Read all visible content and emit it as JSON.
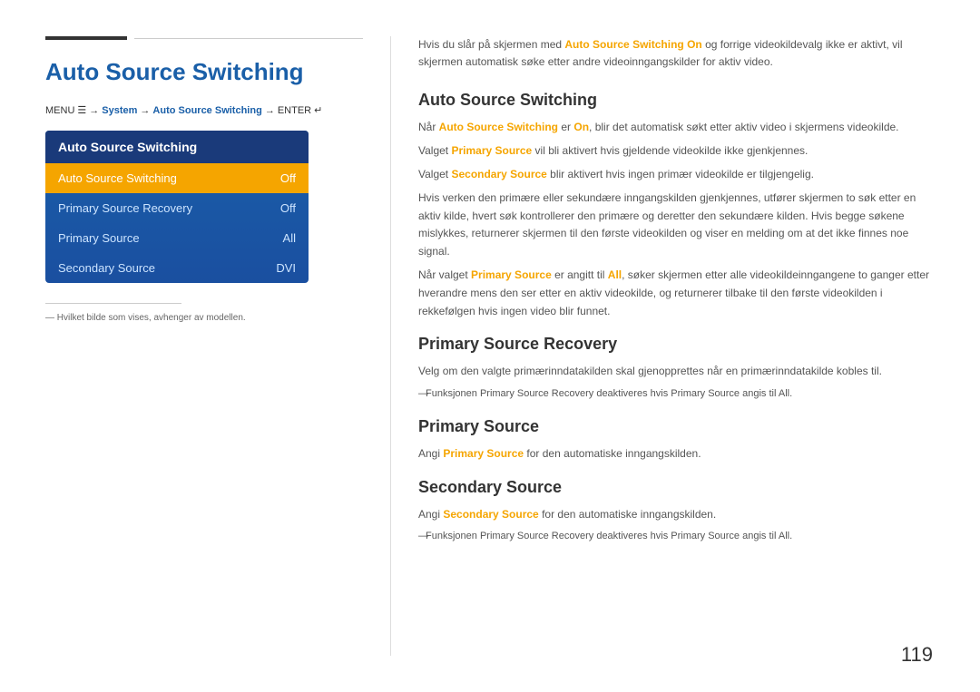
{
  "header": {
    "title": "Auto Source Switching"
  },
  "breadcrumb": {
    "menu": "MENU",
    "arrow1": "→",
    "system": "System",
    "arrow2": "→",
    "link": "Auto Source Switching",
    "arrow3": "→",
    "enter": "ENTER"
  },
  "osd": {
    "header": "Auto Source Switching",
    "items": [
      {
        "label": "Auto Source Switching",
        "value": "Off",
        "active": true
      },
      {
        "label": "Primary Source Recovery",
        "value": "Off",
        "active": false
      },
      {
        "label": "Primary Source",
        "value": "All",
        "active": false
      },
      {
        "label": "Secondary Source",
        "value": "DVI",
        "active": false
      }
    ]
  },
  "footnote": "— Hvilket bilde som vises, avhenger av modellen.",
  "right": {
    "intro": "Hvis du slår på skjermen med Auto Source Switching On og forrige videokildevalg ikke er aktivt, vil skjermen automatisk søke etter andre videoinngangskilder for aktiv video.",
    "sections": [
      {
        "title": "Auto Source Switching",
        "paragraphs": [
          "Når Auto Source Switching er On, blir det automatisk søkt etter aktiv video i skjermens videokilde.",
          "Valget Primary Source vil bli aktivert hvis gjeldende videokilde ikke gjenkjennes.",
          "Valget Secondary Source blir aktivert hvis ingen primær videokilde er tilgjengelig.",
          "Hvis verken den primære eller sekundære inngangskilden gjenkjennes, utfører skjermen to søk etter en aktiv kilde, hvert søk kontrollerer den primære og deretter den sekundære kilden. Hvis begge søkene mislykkes, returnerer skjermen til den første videokilden og viser en melding om at det ikke finnes noe signal.",
          "Når valget Primary Source er angitt til All, søker skjermen etter alle videokildeinngangene to ganger etter hverandre mens den ser etter en aktiv videokilde, og returnerer tilbake til den første videokilden i rekkefølgen hvis ingen video blir funnet."
        ]
      },
      {
        "title": "Primary Source Recovery",
        "paragraphs": [
          "Velg om den valgte primærinndatakilden skal gjenopprettes når en primærinndatakilde kobles til."
        ],
        "notes": [
          "Funksjonen Primary Source Recovery deaktiveres hvis Primary Source angis til All."
        ]
      },
      {
        "title": "Primary Source",
        "paragraphs": [
          "Angi Primary Source for den automatiske inngangskilden."
        ]
      },
      {
        "title": "Secondary Source",
        "paragraphs": [
          "Angi Secondary Source for den automatiske inngangskilden."
        ],
        "notes": [
          "Funksjonen Primary Source Recovery deaktiveres hvis Primary Source angis til All."
        ]
      }
    ]
  },
  "page_number": "119"
}
